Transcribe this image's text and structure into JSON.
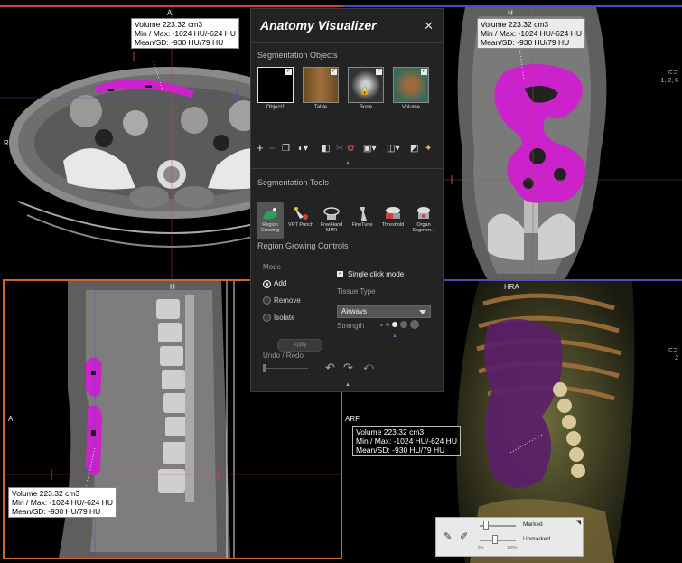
{
  "panel": {
    "title": "Anatomy Visualizer",
    "close_glyph": "✕",
    "seg_objects_header": "Segmentation Objects",
    "objects": [
      {
        "label": "Object1",
        "icon": "object1-thumbnail"
      },
      {
        "label": "Table",
        "icon": "table-thumbnail"
      },
      {
        "label": "Bone",
        "icon": "bone-thumbnail"
      },
      {
        "label": "Volume",
        "icon": "volume-thumbnail"
      }
    ],
    "seg_tools_header": "Segmentation Tools",
    "tools": [
      {
        "label": "Region Growing",
        "active": true
      },
      {
        "label": "VRT Punch"
      },
      {
        "label": "FreeHand MPR"
      },
      {
        "label": "FineTune"
      },
      {
        "label": "Threshold"
      },
      {
        "label": "Organ Segmen..."
      }
    ],
    "rg_header": "Region Growing Controls",
    "mode_label": "Mode",
    "modes": [
      "Add",
      "Remove",
      "Isolate"
    ],
    "selected_mode": "Add",
    "apply_label": "Apply",
    "single_click_label": "Single click mode",
    "tissue_type_label": "Tissue Type",
    "tissue_type_value": "Airways",
    "strength_label": "Strength",
    "undo_redo_label": "Undo / Redo"
  },
  "viewports": {
    "axial": {
      "top": "A",
      "left": "R"
    },
    "coronal": {
      "top": "H",
      "side_badge": [
        "1, 2, 6"
      ]
    },
    "sagittal": {
      "top": "H",
      "left": "A"
    },
    "vrt": {
      "top": "HRA",
      "left": "ARF",
      "side_badge": [
        "2"
      ]
    }
  },
  "measurement": {
    "line1": "Volume 223.32 cm3",
    "line2": "Min / Max: -1024 HU/-624 HU",
    "line3": "Mean/SD: -930 HU/79 HU"
  },
  "overlay": {
    "marked": "Marked",
    "unmarked": "Unmarked",
    "scale_min": "0%",
    "scale_max": "100%"
  },
  "colors": {
    "segmentation": "#cc22cc",
    "panel_bg": "#232323",
    "accent_blue": "#4a4ad0"
  }
}
